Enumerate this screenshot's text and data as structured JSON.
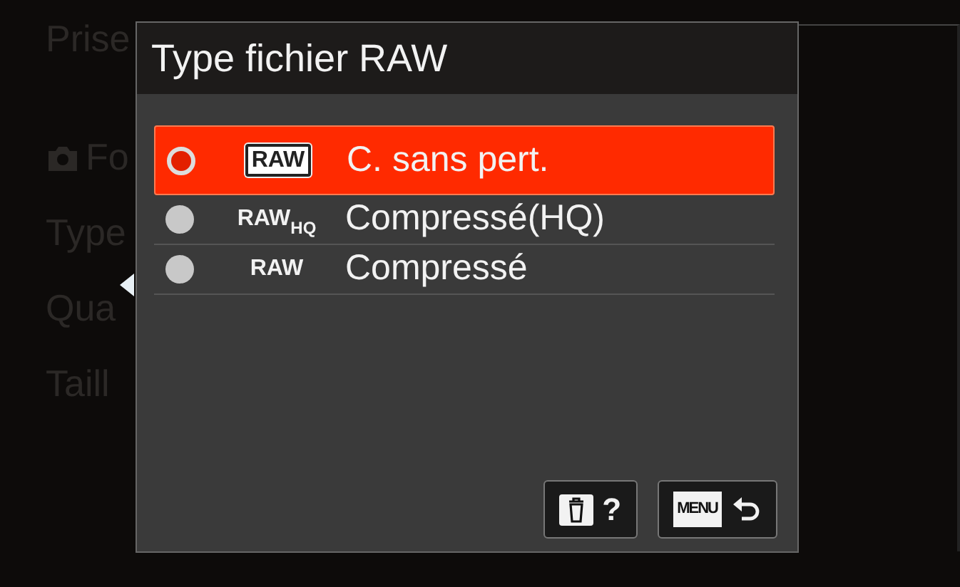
{
  "background_menu": {
    "title": "Prise",
    "items": [
      {
        "kind": "camera",
        "label": "Fo"
      },
      {
        "kind": "text",
        "label": "Type"
      },
      {
        "kind": "text",
        "label": "Qua"
      },
      {
        "kind": "text",
        "label": "Taill"
      }
    ]
  },
  "dialog": {
    "title": "Type fichier RAW",
    "options": [
      {
        "badge": "RAW",
        "boxed": true,
        "label": "C. sans pert.",
        "selected": true
      },
      {
        "badge": "RAW",
        "badge_sub": "HQ",
        "boxed": false,
        "label": "Compressé(HQ)",
        "selected": false
      },
      {
        "badge": "RAW",
        "boxed": false,
        "label": "Compressé",
        "selected": false
      }
    ],
    "footer": [
      {
        "kind": "delete-help",
        "label": "?"
      },
      {
        "kind": "menu-back",
        "key": "MENU"
      }
    ]
  }
}
